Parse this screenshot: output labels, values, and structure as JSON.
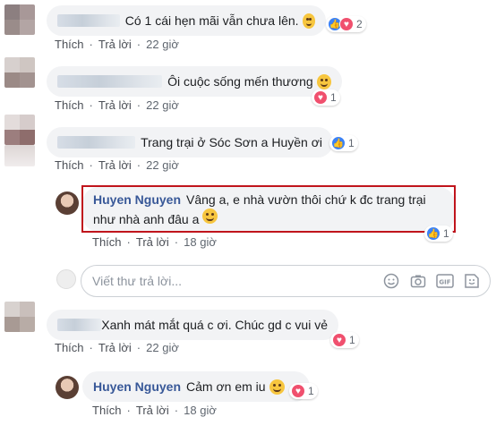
{
  "comments": [
    {
      "text": "Có 1 cái hẹn mãi vẫn chưa lên.",
      "emoji": "tired-face-emoji",
      "reactions": {
        "types": [
          "like",
          "love"
        ],
        "count": "2"
      },
      "actions": {
        "like": "Thích",
        "reply": "Trả lời",
        "time": "22 giờ"
      }
    },
    {
      "text": "Ôi cuộc sống mến thương",
      "emoji": "smile-emoji",
      "reactions": {
        "types": [
          "love"
        ],
        "count": "1"
      },
      "actions": {
        "like": "Thích",
        "reply": "Trả lời",
        "time": "22 giờ"
      }
    },
    {
      "text": "Trang trại ở Sóc Sơn a Huyền ơi",
      "emoji": "",
      "reactions": {
        "types": [
          "like"
        ],
        "count": "1"
      },
      "actions": {
        "like": "Thích",
        "reply": "Trả lời",
        "time": "22 giờ"
      }
    },
    {
      "author": "Huyen Nguyen",
      "line1": "Vâng a, e nhà vườn thôi chứ k đc trang trại",
      "line2": "như nhà anh đâu a",
      "emoji": "laughing-emoji",
      "reactions": {
        "types": [
          "like"
        ],
        "count": "1"
      },
      "actions": {
        "like": "Thích",
        "reply": "Trả lời",
        "time": "18 giờ"
      }
    },
    {
      "text": "Xanh mát mắt quá c ơi. Chúc gd c vui vẻ",
      "reactions": {
        "types": [
          "love"
        ],
        "count": "1"
      },
      "actions": {
        "like": "Thích",
        "reply": "Trả lời",
        "time": "22 giờ"
      }
    },
    {
      "author": "Huyen Nguyen",
      "text": "Cảm ơn em iu",
      "emoji": "heart-eyes-emoji",
      "reactions": {
        "types": [
          "love"
        ],
        "count": "1"
      },
      "actions": {
        "like": "Thích",
        "reply": "Trả lời",
        "time": "18 giờ"
      }
    }
  ],
  "reply_box": {
    "placeholder": "Viết thư trả lời...",
    "tools": [
      "emoji-icon",
      "camera-icon",
      "gif-icon",
      "sticker-icon"
    ]
  },
  "colors": {
    "link": "#385898",
    "like": "#3b82f6",
    "love": "#f0506e",
    "highlight": "#c0141c",
    "bubble": "#f2f3f5"
  }
}
